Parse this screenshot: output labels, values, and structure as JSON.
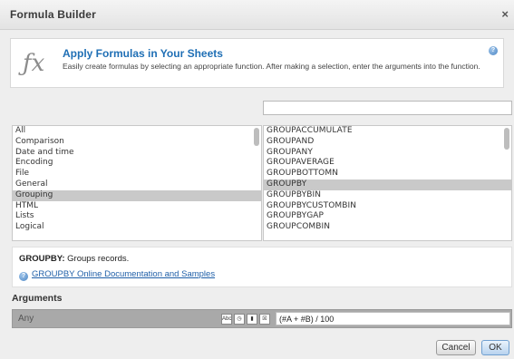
{
  "window": {
    "title": "Formula Builder",
    "close_label": "×"
  },
  "header": {
    "icon": "fx-icon",
    "title": "Apply Formulas in Your Sheets",
    "description": "Easily create formulas by selecting an appropriate function. After making a selection, enter the arguments into the function.",
    "help_glyph": "?"
  },
  "search": {
    "value": "",
    "placeholder": ""
  },
  "categories": {
    "items": [
      "All",
      "Comparison",
      "Date and time",
      "Encoding",
      "File",
      "General",
      "Grouping",
      "HTML",
      "Lists",
      "Logical"
    ],
    "selected": "Grouping"
  },
  "functions": {
    "items": [
      "GROUPACCUMULATE",
      "GROUPAND",
      "GROUPANY",
      "GROUPAVERAGE",
      "GROUPBOTTOMN",
      "GROUPBY",
      "GROUPBYBIN",
      "GROUPBYCUSTOMBIN",
      "GROUPBYGAP",
      "GROUPCOMBIN"
    ],
    "selected": "GROUPBY"
  },
  "info": {
    "function_name": "GROUPBY:",
    "function_desc": "Groups records.",
    "doc_link": "GROUPBY Online Documentation and Samples"
  },
  "arguments": {
    "heading": "Arguments",
    "rows": [
      {
        "label": "Any",
        "value": "(#A + #B) / 100"
      }
    ],
    "tools": [
      "Abc",
      "◷",
      "▮",
      "☒"
    ]
  },
  "buttons": {
    "cancel": "Cancel",
    "ok": "OK"
  }
}
